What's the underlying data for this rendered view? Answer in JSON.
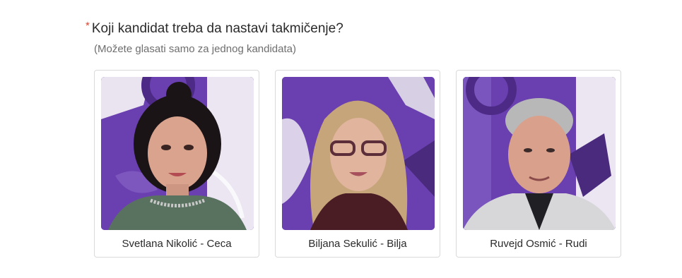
{
  "poll": {
    "required_marker": "*",
    "question": "Koji kandidat treba da nastavi takmičenje?",
    "hint": "(Možete glasati samo za jednog kandidata)"
  },
  "candidates": [
    {
      "name": "Svetlana Nikolić - Ceca"
    },
    {
      "name": "Biljana Sekulić - Bilja"
    },
    {
      "name": "Ruvejd Osmić - Rudi"
    }
  ],
  "colors": {
    "required": "#e0452f",
    "backdrop_purple": "#6a3fb0",
    "card_border": "#d9d9d9"
  }
}
